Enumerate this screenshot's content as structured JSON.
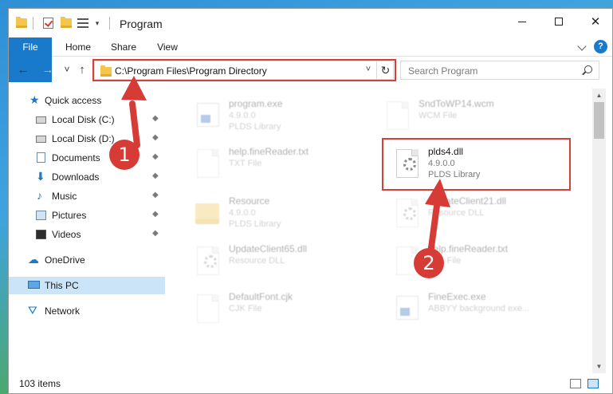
{
  "window": {
    "title": "Program"
  },
  "titlebar": {
    "minimize_label": "—",
    "close_label": "✕"
  },
  "ribbon": {
    "tabs": [
      {
        "label": "File"
      },
      {
        "label": "Home"
      },
      {
        "label": "Share"
      },
      {
        "label": "View"
      }
    ],
    "help_label": "?"
  },
  "nav": {
    "back_glyph": "←",
    "forward_glyph": "→",
    "recent_glyph": "˅",
    "up_glyph": "↑",
    "address": "C:\\Program Files\\Program Directory",
    "address_dropdown_glyph": "˅",
    "refresh_glyph": "↻",
    "search_placeholder": "Search Program"
  },
  "sidebar": {
    "items": [
      {
        "label": "Quick access",
        "icon": "star-icon"
      },
      {
        "label": "Local Disk (C:)",
        "icon": "drive-icon",
        "pinned": true
      },
      {
        "label": "Local Disk (D:)",
        "icon": "drive-icon",
        "pinned": true
      },
      {
        "label": "Documents",
        "icon": "documents-icon",
        "pinned": true
      },
      {
        "label": "Downloads",
        "icon": "downloads-icon",
        "pinned": true
      },
      {
        "label": "Music",
        "icon": "music-icon",
        "pinned": true
      },
      {
        "label": "Pictures",
        "icon": "pictures-icon",
        "pinned": true
      },
      {
        "label": "Videos",
        "icon": "videos-icon",
        "pinned": true
      },
      {
        "label": "OneDrive",
        "icon": "cloud-icon"
      },
      {
        "label": "This PC",
        "icon": "computer-icon",
        "selected": true
      },
      {
        "label": "Network",
        "icon": "network-icon"
      }
    ],
    "pin_glyph": "📌"
  },
  "files": [
    {
      "name": "program.exe",
      "line1": "4.9.0.0",
      "line2": "PLDS Library",
      "icon": "application-icon"
    },
    {
      "name": "SndToWP14.wcm",
      "line1": "WCM File",
      "line2": "",
      "icon": "blank-file-icon"
    },
    {
      "name": "help.fineReader.txt",
      "line1": "TXT File",
      "line2": "",
      "icon": "blank-file-icon"
    },
    {
      "name": "plds4.dll",
      "line1": "4.9.0.0",
      "line2": "PLDS Library",
      "icon": "dll-gear-icon"
    },
    {
      "name": "Resource",
      "line1": "4.9.0.0",
      "line2": "PLDS Library",
      "icon": "folder-icon"
    },
    {
      "name": "UpdateClient21.dll",
      "line1": "Resource DLL",
      "line2": "",
      "icon": "dll-gear-icon"
    },
    {
      "name": "UpdateClient65.dll",
      "line1": "Resource DLL",
      "line2": "",
      "icon": "dll-gear-icon"
    },
    {
      "name": "help.fineReader.txt",
      "line1": "TXT File",
      "line2": "",
      "icon": "blank-file-icon"
    },
    {
      "name": "DefaultFont.cjk",
      "line1": "CJK File",
      "line2": "",
      "icon": "blank-file-icon"
    },
    {
      "name": "FineExec.exe",
      "line1": "ABBYY background exe...",
      "line2": "",
      "icon": "application-icon"
    }
  ],
  "status": {
    "item_count": "103 items"
  },
  "callouts": [
    {
      "label": "1"
    },
    {
      "label": "2"
    }
  ],
  "colors": {
    "accent": "#1979ca",
    "highlight": "#d4413b",
    "selection": "#cce4f7"
  }
}
